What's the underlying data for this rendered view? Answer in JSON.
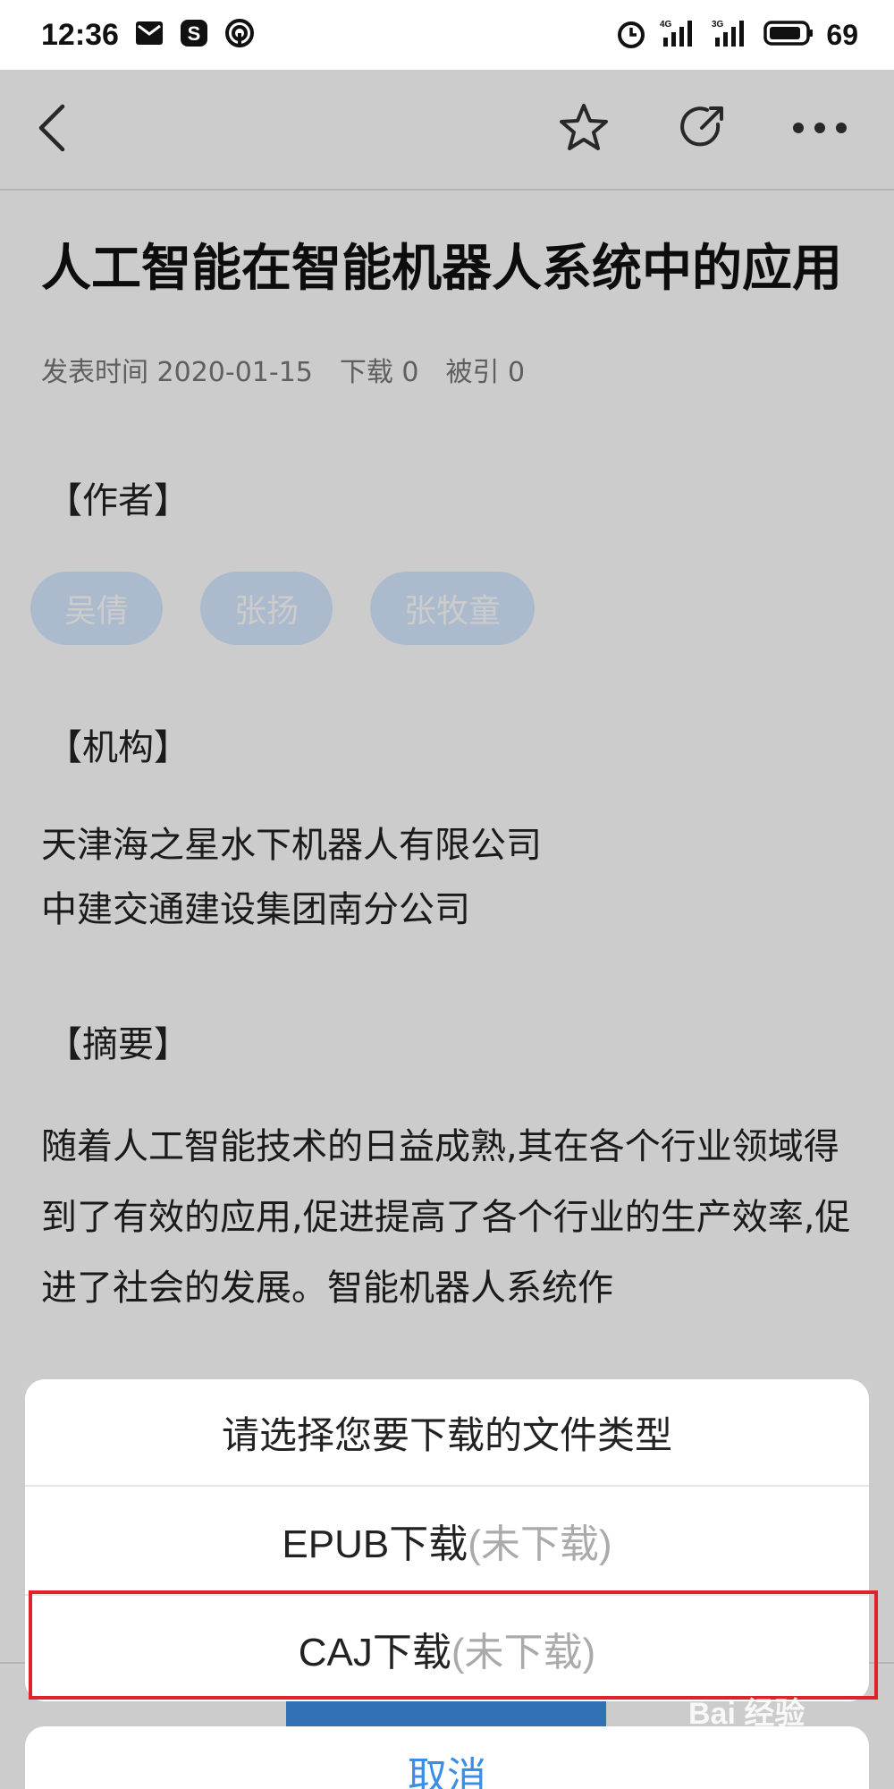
{
  "status_bar": {
    "time": "12:36",
    "battery": "69"
  },
  "toolbar": {
    "back_icon": "chevron-left-icon",
    "favorite_icon": "star-icon",
    "share_icon": "share-icon",
    "more_icon": "more-icon"
  },
  "article": {
    "title": "人工智能在智能机器人系统中的应用",
    "meta": {
      "publish": "发表时间 2020-01-15",
      "downloads": "下载 0",
      "citations": "被引 0"
    },
    "authors_label": "【作者】",
    "authors": [
      "吴倩",
      "张扬",
      "张牧童"
    ],
    "org_label": "【机构】",
    "orgs": [
      "天津海之星水下机器人有限公司",
      "中建交通建设集团南分公司"
    ],
    "abstract_label": "【摘要】",
    "abstract": "随着人工智能技术的日益成熟,其在各个行业领域得到了有效的应用,促进提高了各个行业的生产效率,促进了社会的发展。智能机器人系统作"
  },
  "sheet": {
    "title": "请选择您要下载的文件类型",
    "options": [
      {
        "label": "EPUB下载",
        "status": "(未下载)"
      },
      {
        "label": "CAJ下载",
        "status": "(未下载)"
      }
    ],
    "cancel": "取消"
  },
  "watermark": "Bai 经验"
}
